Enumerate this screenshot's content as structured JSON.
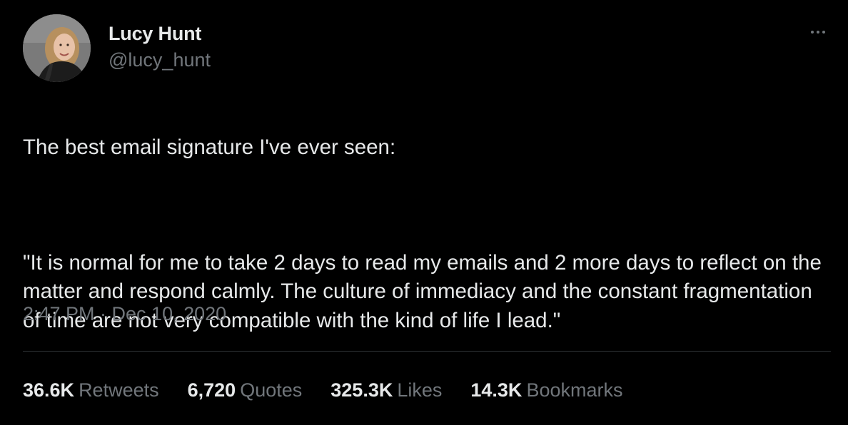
{
  "author": {
    "display_name": "Lucy Hunt",
    "handle": "@lucy_hunt",
    "avatar_icon": "profile-photo"
  },
  "more_icon": "more-horizontal-icon",
  "tweet": {
    "text_line1": "The best email signature I've ever seen:",
    "text_quote": "\"It is normal for me to take 2 days to read my emails and 2 more days to reflect on the matter and respond calmly. The culture of immediacy and the constant fragmentation of time are not very compatible with the kind of life I lead.\"",
    "timestamp": "2:47 PM · Dec 10, 2020"
  },
  "stats": [
    {
      "value": "36.6K",
      "label": "Retweets"
    },
    {
      "value": "6,720",
      "label": "Quotes"
    },
    {
      "value": "325.3K",
      "label": "Likes"
    },
    {
      "value": "14.3K",
      "label": "Bookmarks"
    }
  ],
  "colors": {
    "background": "#000000",
    "primary_text": "#e7e9ea",
    "secondary_text": "#71767b",
    "divider": "#2f3336"
  }
}
